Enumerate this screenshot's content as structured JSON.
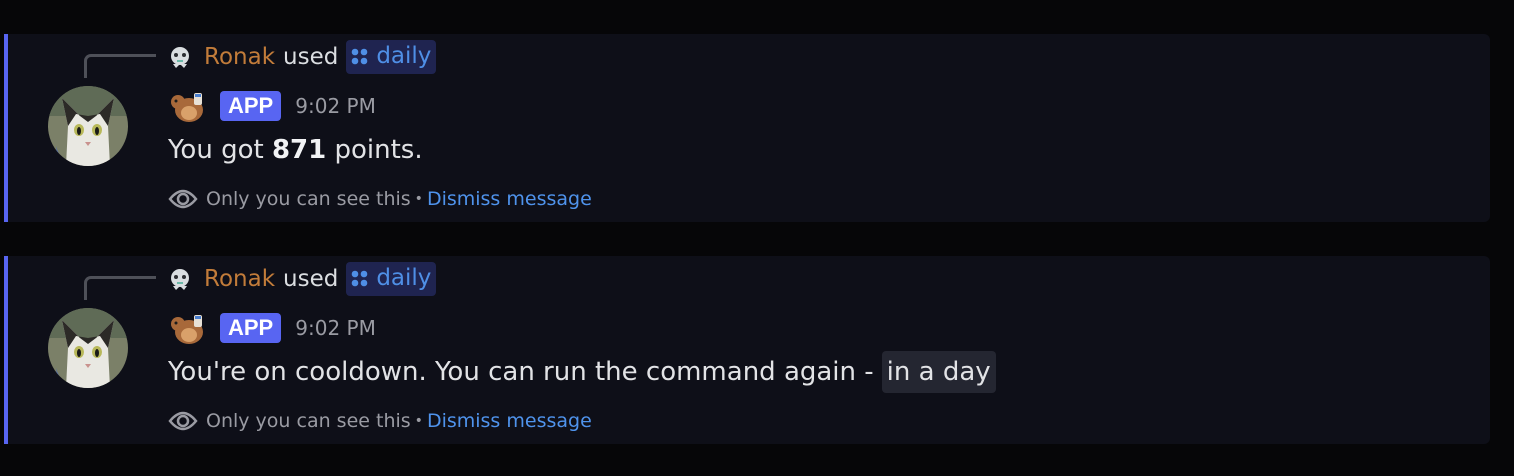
{
  "colors": {
    "accent": "#5865f2",
    "username": "#c27c3a",
    "link": "#4f93ec",
    "command": "#4f8fe6",
    "message_bg": "#0e0f18",
    "page_bg": "#060608"
  },
  "messages": [
    {
      "reply": {
        "username": "Ronak",
        "used_text": "used",
        "command": "daily"
      },
      "header": {
        "badge": "APP",
        "time": "9:02 PM"
      },
      "content": {
        "prefix": "You got ",
        "bold": "871",
        "suffix": " points."
      },
      "ephemeral": {
        "notice": "Only you can see this",
        "separator": "•",
        "dismiss": "Dismiss message"
      }
    },
    {
      "reply": {
        "username": "Ronak",
        "used_text": "used",
        "command": "daily"
      },
      "header": {
        "badge": "APP",
        "time": "9:02 PM"
      },
      "content": {
        "text": "You're on cooldown. You can run the command again -",
        "time_chip": "in a day"
      },
      "ephemeral": {
        "notice": "Only you can see this",
        "separator": "•",
        "dismiss": "Dismiss message"
      }
    }
  ],
  "icons": {
    "reply_avatar": "ghost-avatar-icon",
    "command": "slash-command-icon",
    "bot": "otter-bot-icon",
    "eye": "eye-icon"
  }
}
